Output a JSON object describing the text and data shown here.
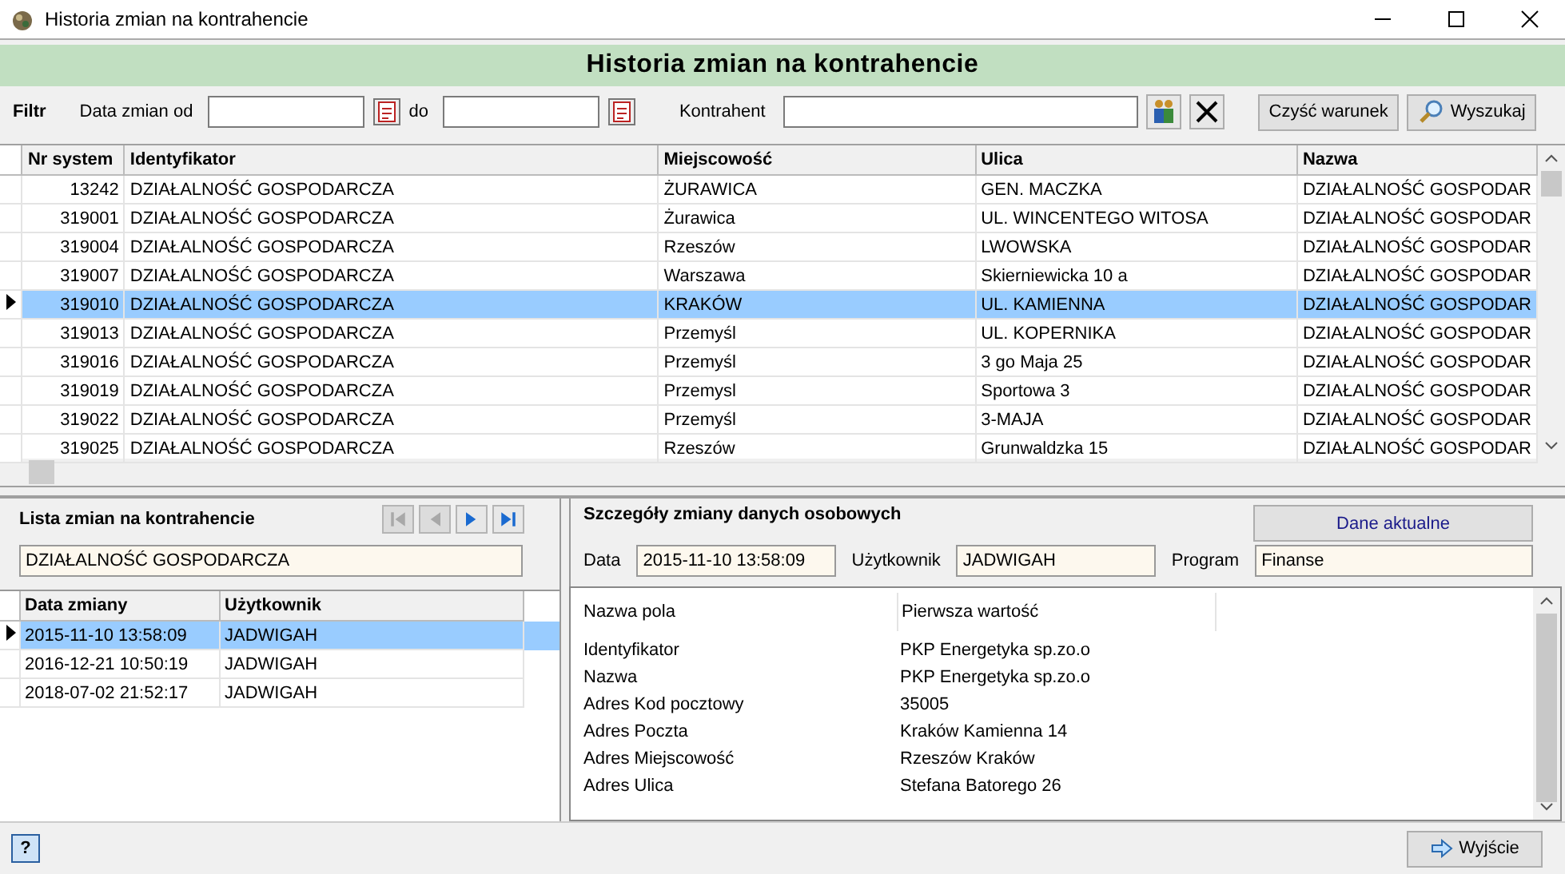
{
  "window": {
    "title": "Historia zmian na kontrahencie"
  },
  "header": {
    "title": "Historia zmian na kontrahencie"
  },
  "filter": {
    "label": "Filtr",
    "date_from_label": "Data zmian od",
    "date_to_label": "do",
    "contractor_label": "Kontrahent",
    "clear_button": "Czyść warunek",
    "search_button": "Wyszukaj"
  },
  "grid": {
    "columns": [
      "Nr system",
      "Identyfikator",
      "Miejscowość",
      "Ulica",
      "Nazwa"
    ],
    "rows": [
      {
        "cells": [
          "13242",
          "DZIAŁALNOŚĆ GOSPODARCZA",
          "ŻURAWICA",
          "GEN. MACZKA",
          "DZIAŁALNOŚĆ GOSPODAR"
        ],
        "selected": false
      },
      {
        "cells": [
          "319001",
          "DZIAŁALNOŚĆ GOSPODARCZA",
          "Żurawica",
          "UL. WINCENTEGO WITOSA",
          "DZIAŁALNOŚĆ GOSPODAR"
        ],
        "selected": false
      },
      {
        "cells": [
          "319004",
          "DZIAŁALNOŚĆ GOSPODARCZA",
          "Rzeszów",
          "LWOWSKA",
          "DZIAŁALNOŚĆ GOSPODAR"
        ],
        "selected": false
      },
      {
        "cells": [
          "319007",
          "DZIAŁALNOŚĆ GOSPODARCZA",
          "Warszawa",
          "Skierniewicka 10 a",
          "DZIAŁALNOŚĆ GOSPODAR"
        ],
        "selected": false
      },
      {
        "cells": [
          "319010",
          "DZIAŁALNOŚĆ GOSPODARCZA",
          "KRAKÓW",
          "UL. KAMIENNA",
          "DZIAŁALNOŚĆ GOSPODAR"
        ],
        "selected": true
      },
      {
        "cells": [
          "319013",
          "DZIAŁALNOŚĆ GOSPODARCZA",
          "Przemyśl",
          "UL. KOPERNIKA",
          "DZIAŁALNOŚĆ GOSPODAR"
        ],
        "selected": false
      },
      {
        "cells": [
          "319016",
          "DZIAŁALNOŚĆ GOSPODARCZA",
          "Przemyśl",
          "3 go Maja 25",
          "DZIAŁALNOŚĆ GOSPODAR"
        ],
        "selected": false
      },
      {
        "cells": [
          "319019",
          "DZIAŁALNOŚĆ GOSPODARCZA",
          "Przemysl",
          "Sportowa 3",
          "DZIAŁALNOŚĆ GOSPODAR"
        ],
        "selected": false
      },
      {
        "cells": [
          "319022",
          "DZIAŁALNOŚĆ GOSPODARCZA",
          "Przemyśl",
          "3-MAJA",
          "DZIAŁALNOŚĆ GOSPODAR"
        ],
        "selected": false
      },
      {
        "cells": [
          "319025",
          "DZIAŁALNOŚĆ GOSPODARCZA",
          "Rzeszów",
          "Grunwaldzka 15",
          "DZIAŁALNOŚĆ GOSPODAR"
        ],
        "selected": false
      }
    ]
  },
  "changes_panel": {
    "title": "Lista zmian na kontrahencie",
    "nav": [
      {
        "kind": "first",
        "disabled": true
      },
      {
        "kind": "prev",
        "disabled": true
      },
      {
        "kind": "next",
        "disabled": false
      },
      {
        "kind": "last",
        "disabled": false
      }
    ],
    "contractor_value": "DZIAŁALNOŚĆ GOSPODARCZA",
    "columns": [
      "Data zmiany",
      "Użytkownik"
    ],
    "rows": [
      {
        "cells": [
          "2015-11-10 13:58:09",
          "JADWIGAH"
        ],
        "selected": true
      },
      {
        "cells": [
          "2016-12-21 10:50:19",
          "JADWIGAH"
        ],
        "selected": false
      },
      {
        "cells": [
          "2018-07-02 21:52:17",
          "JADWIGAH"
        ],
        "selected": false
      }
    ]
  },
  "details_panel": {
    "title": "Szczegóły zmiany danych osobowych",
    "current_button": "Dane aktualne",
    "fields": [
      {
        "label": "Data",
        "value": "2015-11-10 13:58:09"
      },
      {
        "label": "Użytkownik",
        "value": "JADWIGAH"
      },
      {
        "label": "Program",
        "value": "Finanse"
      }
    ],
    "columns": [
      "Nazwa pola",
      "Pierwsza wartość"
    ],
    "rows": [
      [
        "Identyfikator",
        "PKP Energetyka sp.zo.o"
      ],
      [
        "Nazwa",
        "PKP Energetyka sp.zo.o"
      ],
      [
        "Adres Kod pocztowy",
        "35005"
      ],
      [
        "Adres Poczta",
        "Kraków  Kamienna 14"
      ],
      [
        "Adres Miejscowość",
        "Rzeszów Kraków"
      ],
      [
        "Adres Ulica",
        "Stefana Batorego 26"
      ]
    ]
  },
  "footer": {
    "help_button": "?",
    "exit_button": "Wyjście"
  }
}
